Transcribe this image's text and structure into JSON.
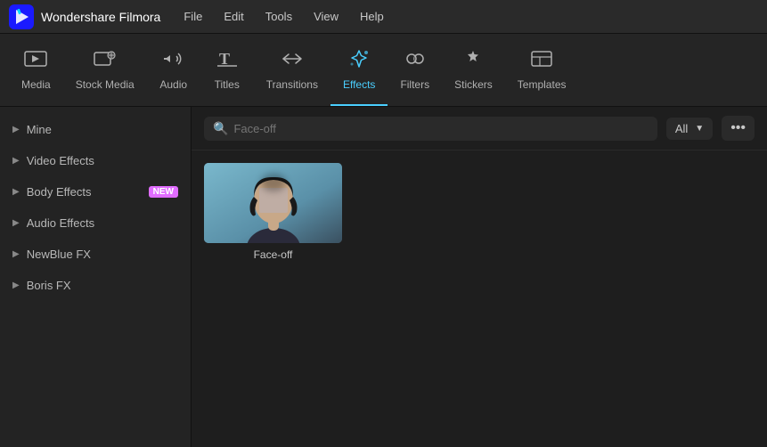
{
  "app": {
    "name": "Wondershare Filmora"
  },
  "menu": {
    "items": [
      "File",
      "Edit",
      "Tools",
      "View",
      "Help"
    ]
  },
  "toolbar": {
    "items": [
      {
        "id": "media",
        "label": "Media",
        "icon": "🎬"
      },
      {
        "id": "stock-media",
        "label": "Stock Media",
        "icon": "📷"
      },
      {
        "id": "audio",
        "label": "Audio",
        "icon": "🎵"
      },
      {
        "id": "titles",
        "label": "Titles",
        "icon": "T"
      },
      {
        "id": "transitions",
        "label": "Transitions",
        "icon": "↔"
      },
      {
        "id": "effects",
        "label": "Effects",
        "icon": "✨",
        "active": true
      },
      {
        "id": "filters",
        "label": "Filters",
        "icon": "🎨"
      },
      {
        "id": "stickers",
        "label": "Stickers",
        "icon": "⭐"
      },
      {
        "id": "templates",
        "label": "Templates",
        "icon": "▣"
      }
    ]
  },
  "sidebar": {
    "items": [
      {
        "id": "mine",
        "label": "Mine",
        "badge": null
      },
      {
        "id": "video-effects",
        "label": "Video Effects",
        "badge": null
      },
      {
        "id": "body-effects",
        "label": "Body Effects",
        "badge": "NEW"
      },
      {
        "id": "audio-effects",
        "label": "Audio Effects",
        "badge": null
      },
      {
        "id": "newblue-fx",
        "label": "NewBlue FX",
        "badge": null
      },
      {
        "id": "boris-fx",
        "label": "Boris FX",
        "badge": null
      }
    ]
  },
  "search": {
    "placeholder": "Face-off",
    "filter_label": "All",
    "more_icon": "···"
  },
  "effects": [
    {
      "id": "face-off",
      "name": "Face-off"
    }
  ],
  "colors": {
    "active_tab": "#4acfff",
    "new_badge_bg": "#e06cff",
    "sidebar_bg": "#232323",
    "content_bg": "#1e1e1e"
  }
}
